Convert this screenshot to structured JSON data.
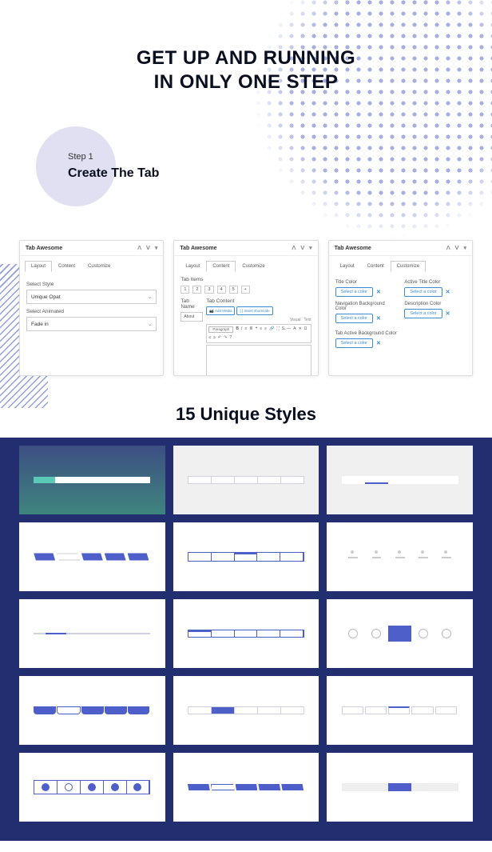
{
  "hero": {
    "line1": "GET UP AND RUNNING",
    "line2": "IN ONLY ONE STEP"
  },
  "step": {
    "label": "Step 1",
    "title": "Create The Tab"
  },
  "panel": {
    "title": "Tab Awesome",
    "tabs": {
      "layout": "Layout",
      "content": "Content",
      "customize": "Customize"
    }
  },
  "panel1": {
    "selectStyleLabel": "Select Style",
    "selectStyleValue": "Unique Opat",
    "selectAnimatedLabel": "Select Animated",
    "selectAnimatedValue": "Fade in"
  },
  "panel2": {
    "tabItemsLabel": "Tab Items",
    "tabNameLabel": "Tab Name",
    "tabNameValue": "About",
    "tabContentLabel": "Tab Content",
    "addMedia": "Add Media",
    "insertShortcode": "Insert shortcode",
    "visual": "Visual",
    "text": "Text",
    "paragraph": "Paragraph"
  },
  "panel3": {
    "titleColor": "Title Color",
    "activeTitleColor": "Active Title Color",
    "navBgColor": "Navigation Background Color",
    "descColor": "Description Color",
    "tabActiveBgColor": "Tab Active Background Color",
    "selectColor": "Select a color"
  },
  "styles": {
    "heading": "15 Unique Styles"
  }
}
